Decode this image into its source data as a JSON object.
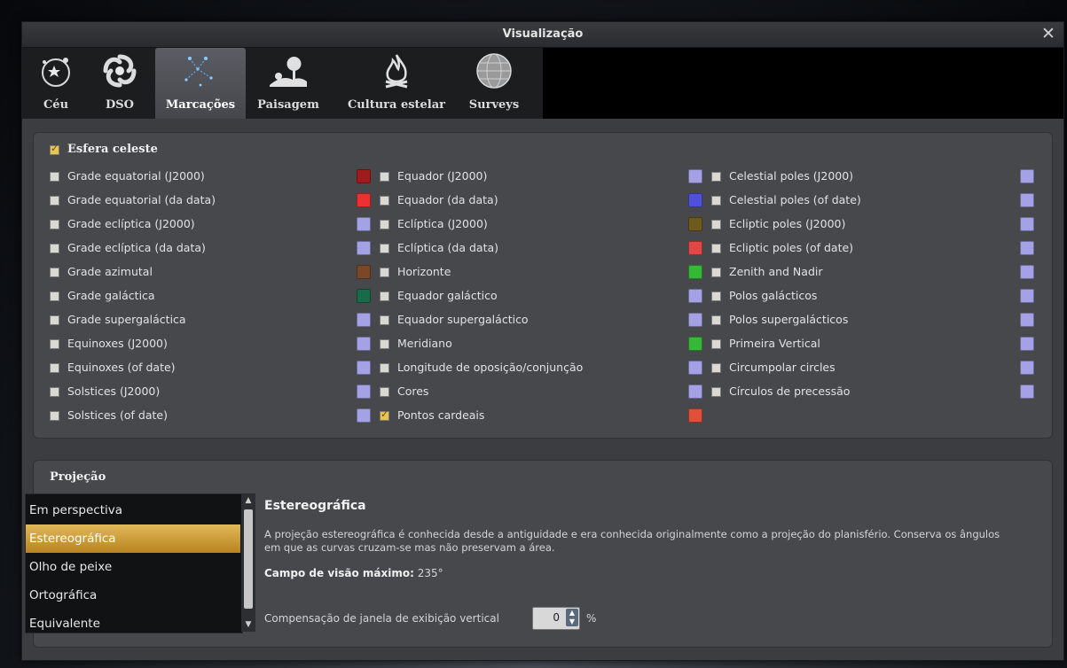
{
  "window": {
    "title": "Visualização",
    "close_glyph": "✕"
  },
  "tabs": [
    {
      "label": "Céu",
      "icon": "sky-icon",
      "active": false
    },
    {
      "label": "DSO",
      "icon": "galaxy-icon",
      "active": false
    },
    {
      "label": "Marcações",
      "icon": "constellation-icon",
      "active": true
    },
    {
      "label": "Paisagem",
      "icon": "landscape-icon",
      "active": false
    },
    {
      "label": "Cultura estelar",
      "icon": "campfire-icon",
      "active": false
    },
    {
      "label": "Surveys",
      "icon": "globe-icon",
      "active": false
    }
  ],
  "markings": {
    "header": "Esfera celeste",
    "header_checked": true,
    "col1": [
      {
        "label": "Grade equatorial (J2000)",
        "checked": false,
        "color": "#a01c1c"
      },
      {
        "label": "Grade equatorial (da data)",
        "checked": false,
        "color": "#ee3030"
      },
      {
        "label": "Grade eclíptica (J2000)",
        "checked": false,
        "color": "#a4a2e4"
      },
      {
        "label": "Grade eclíptica (da data)",
        "checked": false,
        "color": "#a4a2e4"
      },
      {
        "label": "Grade azimutal",
        "checked": false,
        "color": "#7a4828"
      },
      {
        "label": "Grade galáctica",
        "checked": false,
        "color": "#186a48"
      },
      {
        "label": "Grade supergaláctica",
        "checked": false,
        "color": "#a4a2e4"
      },
      {
        "label": "Equinoxes (J2000)",
        "checked": false,
        "color": "#a4a2e4"
      },
      {
        "label": "Equinoxes (of date)",
        "checked": false,
        "color": "#a4a2e4"
      },
      {
        "label": "Solstices (J2000)",
        "checked": false,
        "color": "#a4a2e4"
      },
      {
        "label": "Solstices (of date)",
        "checked": false,
        "color": "#a4a2e4"
      }
    ],
    "col2": [
      {
        "label": "Equador (J2000)",
        "checked": false,
        "color": "#a4a2e4"
      },
      {
        "label": "Equador (da data)",
        "checked": false,
        "color": "#5050d8"
      },
      {
        "label": "Eclíptica (J2000)",
        "checked": false,
        "color": "#6e5a1c"
      },
      {
        "label": "Eclíptica (da data)",
        "checked": false,
        "color": "#e04848"
      },
      {
        "label": "Horizonte",
        "checked": false,
        "color": "#38b838"
      },
      {
        "label": "Equador galáctico",
        "checked": false,
        "color": "#a4a2e4"
      },
      {
        "label": "Equador supergaláctico",
        "checked": false,
        "color": "#a4a2e4"
      },
      {
        "label": "Meridiano",
        "checked": false,
        "color": "#38b838"
      },
      {
        "label": "Longitude de oposição/conjunção",
        "checked": false,
        "color": "#a4a2e4"
      },
      {
        "label": "Cores",
        "checked": false,
        "color": "#a4a2e4"
      },
      {
        "label": "Pontos cardeais",
        "checked": true,
        "color": "#e05038"
      }
    ],
    "col3": [
      {
        "label": "Celestial poles (J2000)",
        "checked": false,
        "color": "#a4a2e4"
      },
      {
        "label": "Celestial poles (of date)",
        "checked": false,
        "color": "#a4a2e4"
      },
      {
        "label": "Ecliptic poles (J2000)",
        "checked": false,
        "color": "#a4a2e4"
      },
      {
        "label": "Ecliptic poles (of date)",
        "checked": false,
        "color": "#a4a2e4"
      },
      {
        "label": "Zenith and Nadir",
        "checked": false,
        "color": "#a4a2e4"
      },
      {
        "label": "Polos galácticos",
        "checked": false,
        "color": "#a4a2e4"
      },
      {
        "label": "Polos supergalácticos",
        "checked": false,
        "color": "#a4a2e4"
      },
      {
        "label": "Primeira Vertical",
        "checked": false,
        "color": "#a4a2e4"
      },
      {
        "label": "Circumpolar circles",
        "checked": false,
        "color": "#a4a2e4"
      },
      {
        "label": "Círculos de precessão",
        "checked": false,
        "color": "#a4a2e4"
      }
    ]
  },
  "projection": {
    "header": "Projeção",
    "items": [
      "Em perspectiva",
      "Estereográfica",
      "Olho de peixe",
      "Ortográfica",
      "Equivalente"
    ],
    "selected_index": 1,
    "title": "Estereográfica",
    "description": "A projeção estereográfica é conhecida desde a antiguidade e era conhecida originalmente como a projeção do planisfério. Conserva os ângulos em que as curvas cruzam-se mas não preservam a área.",
    "fov_label": "Campo de visão máximo:",
    "fov_value": "235°",
    "offset_label": "Compensação de janela de exibição vertical",
    "offset_value": "0",
    "offset_unit": "%"
  }
}
